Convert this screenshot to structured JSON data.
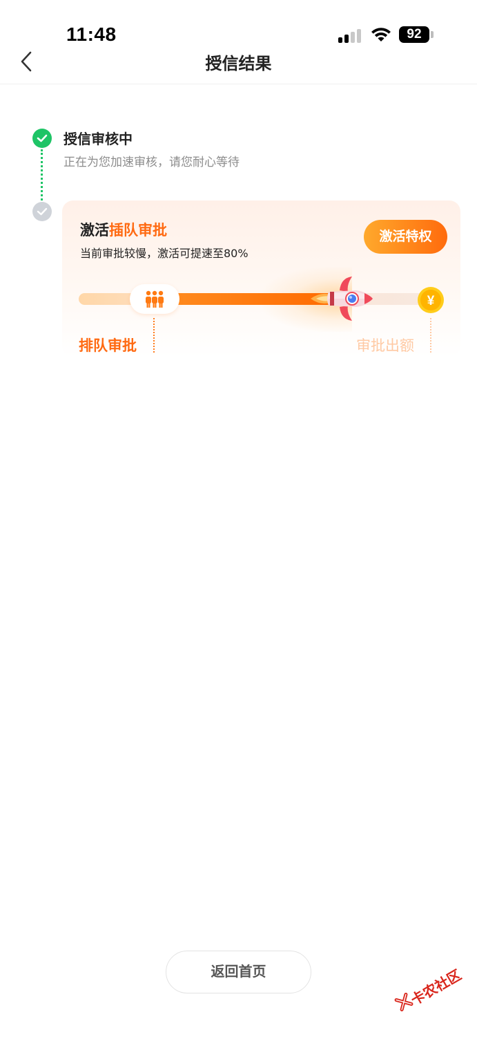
{
  "status_bar": {
    "time": "11:48",
    "battery": "92"
  },
  "nav": {
    "title": "授信结果"
  },
  "steps": [
    {
      "title": "授信审核中",
      "subtitle": "正在为您加速审核，请您耐心等待"
    }
  ],
  "card": {
    "title_prefix": "激活",
    "title_highlight": "插队审批",
    "subtitle": "当前审批较慢，激活可提速至80%",
    "button_label": "激活特权",
    "progress_label_left": "排队审批",
    "progress_label_right": "审批出额",
    "coin_symbol": "¥",
    "accent_color": "#ff6a12"
  },
  "footer": {
    "home_button_label": "返回首页"
  },
  "watermark": {
    "text": "卡农社区"
  }
}
